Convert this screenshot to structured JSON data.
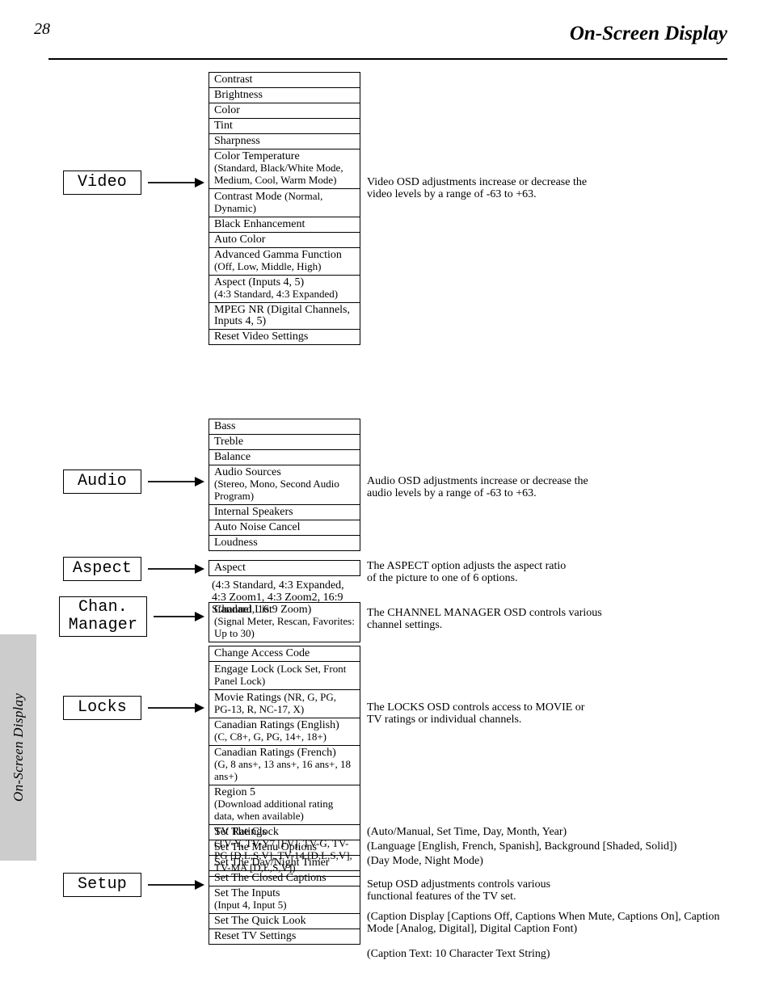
{
  "page_number": "28",
  "side_tab": "On-Screen Display",
  "heading": "On-Screen Display",
  "cats": {
    "video": "Video",
    "audio": "Audio",
    "aspect": "Aspect",
    "chmgr1": "Chan.",
    "chmgr2": "Manager",
    "locks": "Locks",
    "setup": "Setup"
  },
  "video_items": [
    "Contrast",
    "Brightness",
    "Color",
    "Tint",
    "Sharpness",
    "Color Temperature",
    "Contrast Mode",
    "Black Enhancement",
    "Auto Color",
    "Advanced Gamma Function",
    "Aspect (Inputs 4, 5)",
    "MPEG NR (Digital Channels, Inputs 4, 5)",
    "Reset Video Settings"
  ],
  "video_notes": {
    "ct": "(Standard, Black/White Mode, Medium, Cool, Warm Mode)",
    "cm": "(Normal, Dynamic)",
    "agf": "(Off, Low, Middle, High)",
    "asp": "(4:3 Standard, 4:3 Expanded)"
  },
  "audio_items": [
    "Bass",
    "Treble",
    "Balance",
    "Audio Sources",
    "Internal Speakers",
    "Auto Noise Cancel",
    "Loudness"
  ],
  "audio_notes": {
    "as": "(Stereo, Mono, Second Audio Program)"
  },
  "aspect_items": [
    "Aspect"
  ],
  "aspect_note": "(4:3 Standard, 4:3 Expanded, 4:3 Zoom1, 4:3 Zoom2, 16:9 Standard, 16:9 Zoom)",
  "chan_items": [
    "Channel List"
  ],
  "chan_note": "(Signal Meter, Rescan, Favorites: Up to 30)",
  "locks_items": [
    "Change Access Code",
    "Engage Lock",
    "Movie Ratings",
    "Canadian Ratings (English)",
    "Canadian Ratings (French)",
    "Region 5",
    "TV Ratings"
  ],
  "locks_notes": {
    "el": "(Lock Set, Front Panel Lock)",
    "mr": "(NR, G, PG, PG-13, R, NC-17, X)",
    "ce": "(C, C8+, G, PG, 14+, 18+)",
    "cf": "(G, 8 ans+, 13 ans+, 16 ans+, 18 ans+)",
    "r5": "(Download additional rating data, when available)",
    "tv": "(TV-Y, TV-Y7 [FV], TV-G, TV-PG [D,L,S,V], TV-14 [D,L,S,V], TV-MA [D,L,S,V])"
  },
  "setup_items": [
    "Set The Clock",
    "Set The Menu Options",
    "Set The Day/Night Timer",
    "Set The Closed Captions",
    "Set The Inputs",
    "Set The Quick Look",
    "Reset TV Settings"
  ],
  "setup_notes": {
    "clock": "(Auto/Manual, Set Time, Day, Month, Year)",
    "menu": "(Language [English, French, Spanish], Background [Shaded, Solid])",
    "dn": "(Day Mode, Night Mode)",
    "cc": "(Caption Display [Captions Off, Captions When Mute, Captions On], Caption Mode [Analog, Digital], Digital Caption Font)",
    "in": "(Input 4, Input 5)",
    "ql": "(Caption Text: 10 Character Text String)"
  },
  "descs": {
    "video": [
      "Video OSD adjustments increase or decrease the",
      "video levels by a range of -63 to +63."
    ],
    "audio": [
      "Audio OSD adjustments increase or decrease the",
      "audio levels by a range of -63 to +63."
    ],
    "aspect": [
      "The ASPECT option adjusts the aspect ratio",
      "of the picture to one of 6 options."
    ],
    "chan": [
      "The CHANNEL MANAGER OSD controls various",
      "channel settings."
    ],
    "locks": [
      "The LOCKS OSD controls access to MOVIE or",
      "TV ratings or individual channels."
    ],
    "setup": [
      "Setup OSD adjustments controls various",
      "functional features of the TV set."
    ]
  }
}
